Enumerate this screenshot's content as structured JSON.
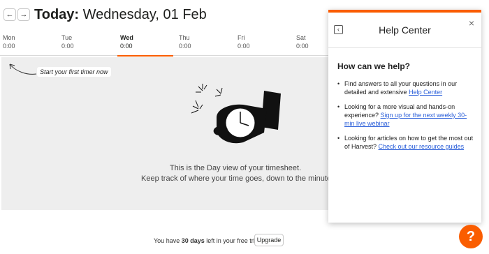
{
  "header": {
    "prev_label": "←",
    "next_label": "→",
    "title_bold": "Today:",
    "title_rest": " Wednesday, 01 Feb"
  },
  "days": [
    {
      "name": "Mon",
      "time": "0:00"
    },
    {
      "name": "Tue",
      "time": "0:00"
    },
    {
      "name": "Wed",
      "time": "0:00"
    },
    {
      "name": "Thu",
      "time": "0:00"
    },
    {
      "name": "Fri",
      "time": "0:00"
    },
    {
      "name": "Sat",
      "time": "0:00"
    }
  ],
  "main": {
    "hint": "Start your first timer now",
    "empty_line1": "This is the Day view of your timesheet.",
    "empty_line2": "Keep track of where your time goes, down to the minute"
  },
  "footer": {
    "trial_prefix": "You have ",
    "trial_days": "30 days",
    "trial_suffix": " left in your free trial.",
    "upgrade_label": "Upgrade"
  },
  "help_center": {
    "title": "Help Center",
    "back_icon": "‹",
    "close_icon": "×",
    "heading": "How can we help?",
    "items": [
      {
        "text": "Find answers to all your questions in our detailed and extensive ",
        "link": "Help Center"
      },
      {
        "text": "Looking for a more visual and hands-on experience? ",
        "link": "Sign up for the next weekly 30-min live webinar"
      },
      {
        "text": "Looking for articles on how to get the most out of Harvest? ",
        "link": "Check out our resource guides"
      }
    ]
  },
  "help_fab": {
    "label": "?"
  },
  "colors": {
    "accent": "#fa5d00",
    "link": "#2b5fd9",
    "panel": "#eeeeee"
  }
}
